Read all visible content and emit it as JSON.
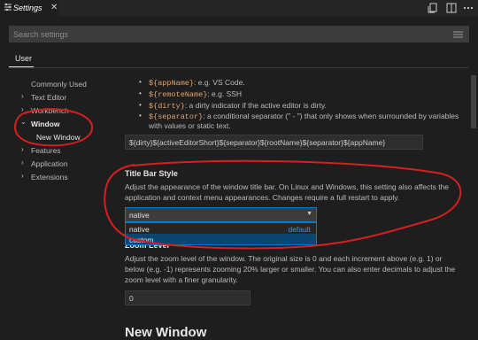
{
  "tab": {
    "title": "Settings",
    "close_glyph": "✕"
  },
  "toolbar": {
    "icons": [
      "open-settings-json-icon",
      "split-editor-icon",
      "more-actions-icon"
    ]
  },
  "search": {
    "placeholder": "Search settings"
  },
  "scope_tabs": [
    {
      "label": "User",
      "active": true
    }
  ],
  "tree": {
    "items": [
      {
        "label": "Commonly Used"
      },
      {
        "label": "Text Editor",
        "chevron": "›"
      },
      {
        "label": "Workbench",
        "chevron": "›"
      },
      {
        "label": "Window",
        "chevron": "⌄",
        "expanded": true
      },
      {
        "label": "New Window",
        "child": true,
        "selected": true
      },
      {
        "label": "Features",
        "chevron": "›"
      },
      {
        "label": "Application",
        "chevron": "›"
      },
      {
        "label": "Extensions",
        "chevron": "›"
      }
    ]
  },
  "title_vars": [
    {
      "var": "${appName}",
      "desc": ": e.g. VS Code."
    },
    {
      "var": "${remoteName}",
      "desc": ": e.g. SSH"
    },
    {
      "var": "${dirty}",
      "desc": ": a dirty indicator if the active editor is dirty."
    },
    {
      "var": "${separator}",
      "desc": ": a conditional separator (\" - \") that only shows when surrounded by variables",
      "desc2": "with values or static text."
    }
  ],
  "title_value": "${dirty}${activeEditorShort}${separator}${rootName}${separator}${appName}",
  "title_bar_style": {
    "heading": "Title Bar Style",
    "desc_line1": "Adjust the appearance of the window title bar. On Linux and Windows, this setting also affects the",
    "desc_line2": "application and context menu appearances. Changes require a full restart to apply.",
    "value": "native",
    "arrow": "▼",
    "options": [
      {
        "label": "native",
        "badge": "default"
      },
      {
        "label": "custom"
      }
    ]
  },
  "zoom_level": {
    "heading": "Zoom Level",
    "desc_line1": "Adjust the zoom level of the window. The original size is 0 and each increment above (e.g. 1) or",
    "desc_line2": "below (e.g. -1) represents zooming 20% larger or smaller. You can also enter decimals to adjust the",
    "desc_line3": "zoom level with a finer granularity.",
    "value": "0"
  },
  "section_heading": "New Window",
  "colors": {
    "background": "#1e1e1e",
    "accent": "#007acc",
    "variable": "#e3a36b",
    "default_badge": "#3794ff",
    "selection": "#094771",
    "annotation": "#d81e1e"
  }
}
